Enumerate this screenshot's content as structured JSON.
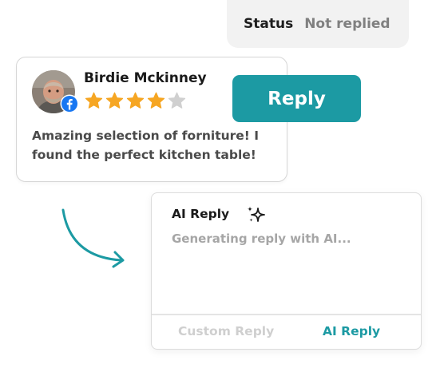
{
  "status": {
    "label": "Status",
    "value": "Not replied"
  },
  "review": {
    "reviewer_name": "Birdie Mckinney",
    "source_icon": "facebook-icon",
    "rating": 4,
    "max_rating": 5,
    "text": "Amazing selection of forniture! I found the perfect kitchen table!"
  },
  "reply_button": {
    "label": "Reply"
  },
  "ai_panel": {
    "title": "AI Reply",
    "status_text": "Generating reply with AI...",
    "tabs": [
      {
        "label": "Custom Reply",
        "active": false
      },
      {
        "label": "AI Reply",
        "active": true
      }
    ]
  },
  "colors": {
    "accent": "#1c9aa3",
    "star_filled": "#f6a623",
    "star_empty": "#d0d0d0",
    "facebook": "#1877f2"
  }
}
